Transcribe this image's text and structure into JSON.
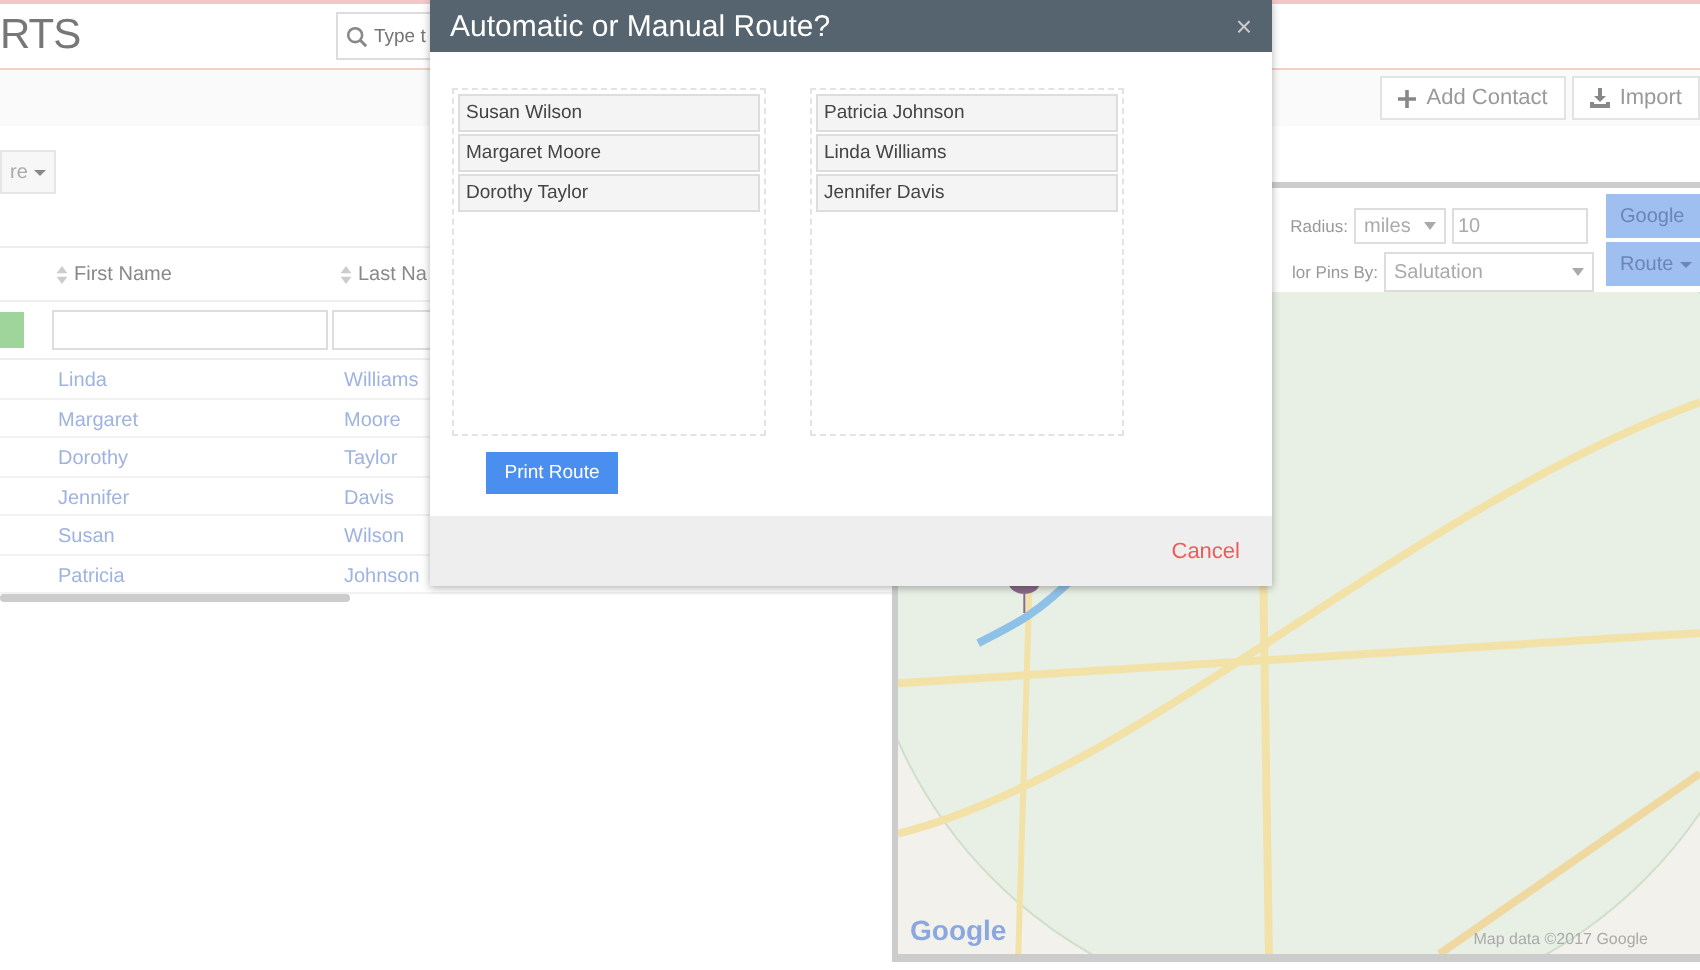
{
  "page": {
    "title": "RTS",
    "search": {
      "placeholder": "Type t"
    },
    "toolbar": [
      {
        "label": "Add Contact",
        "kind": "add"
      },
      {
        "label": "Import",
        "kind": "import"
      }
    ],
    "filter_dropdown": "re",
    "table": {
      "columns": [
        "First Name",
        "Last Na"
      ],
      "rows": [
        [
          "Linda",
          "Williams"
        ],
        [
          "Margaret",
          "Moore"
        ],
        [
          "Dorothy",
          "Taylor"
        ],
        [
          "Jennifer",
          "Davis"
        ],
        [
          "Susan",
          "Wilson"
        ],
        [
          "Patricia",
          "Johnson"
        ]
      ]
    }
  },
  "map_panel": {
    "radius_label": "Radius:",
    "radius_unit": "miles",
    "radius_value": "10",
    "color_pins_label": "lor Pins By:",
    "color_pins_value": "Salutation",
    "buttons": [
      {
        "label": "Google",
        "caret": false
      },
      {
        "label": "Route",
        "caret": true
      }
    ],
    "map": {
      "logo": "Google",
      "attribution": "Map data ©2017 Google"
    }
  },
  "dialog": {
    "title": "Automatic or Manual Route?",
    "close": "×",
    "lists": [
      [
        "Susan Wilson",
        "Margaret Moore",
        "Dorothy Taylor"
      ],
      [
        "Patricia Johnson",
        "Linda Williams",
        "Jennifer Davis"
      ]
    ],
    "print_button": "Print Route",
    "cancel_button": "Cancel"
  }
}
